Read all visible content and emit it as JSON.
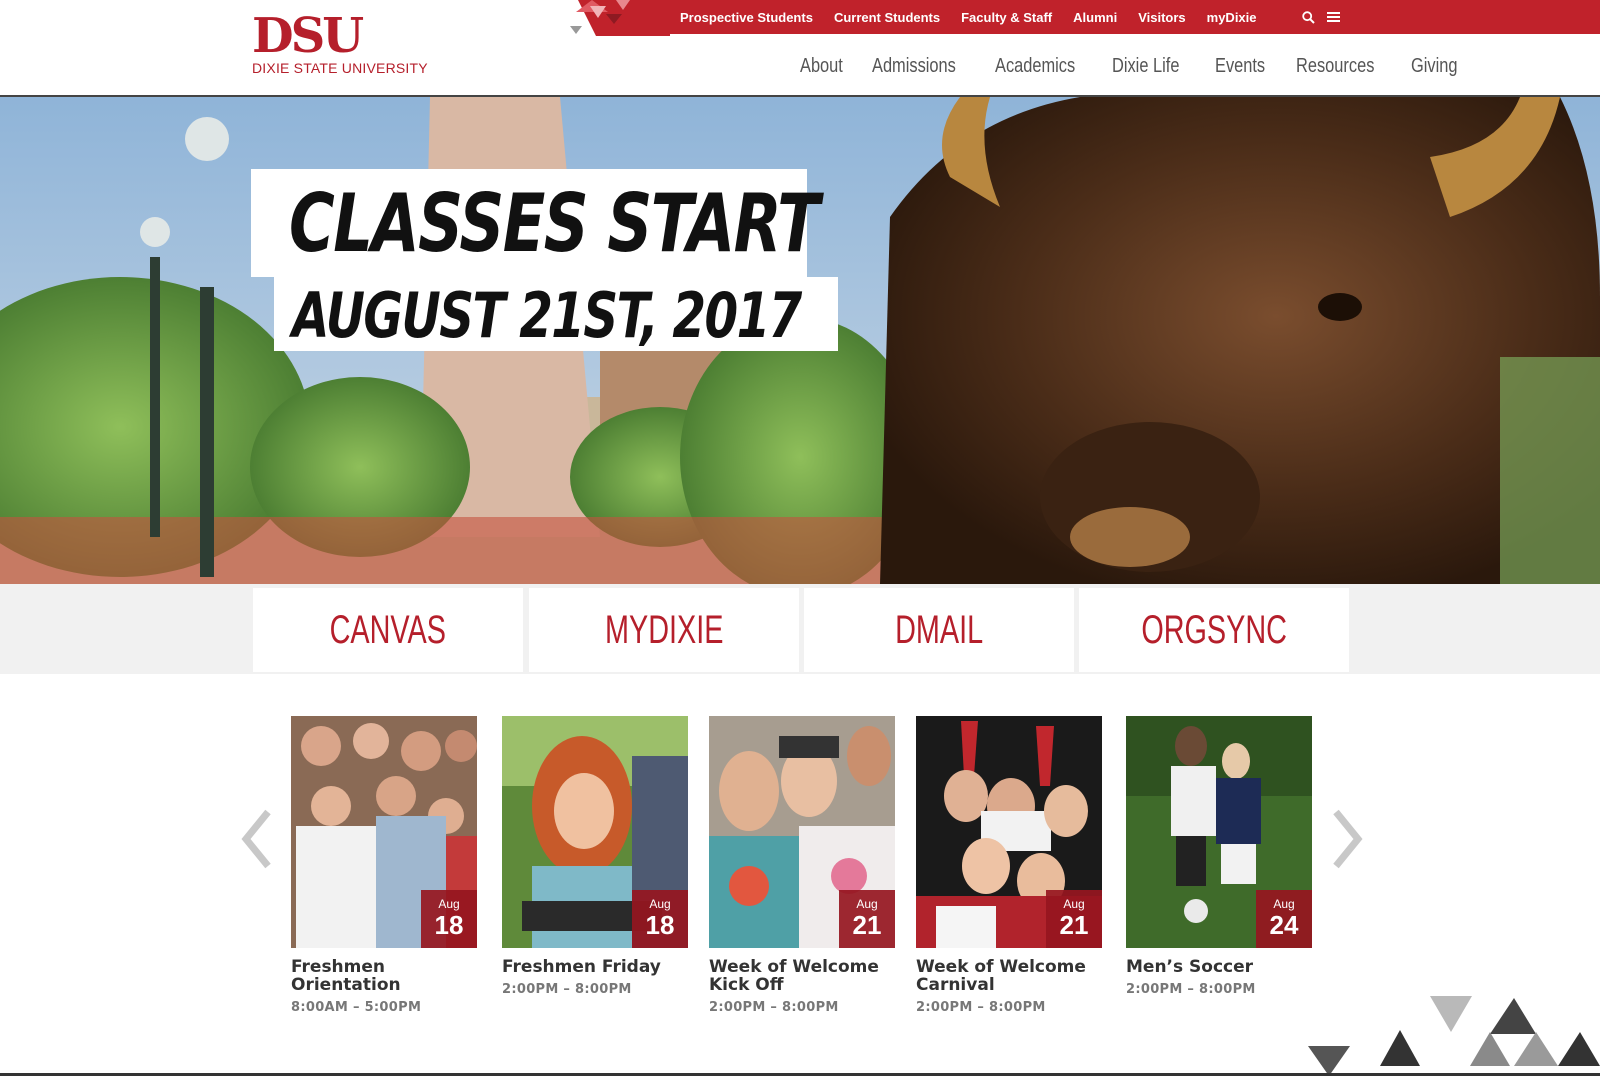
{
  "header": {
    "logo_mark": "DSU",
    "logo_sub": "DIXIE STATE UNIVERSITY",
    "top_links": [
      "Prospective Students",
      "Current Students",
      "Faculty & Staff",
      "Alumni",
      "Visitors",
      "myDixie"
    ],
    "main_links": [
      "About",
      "Admissions",
      "Academics",
      "Dixie Life",
      "Events",
      "Resources",
      "Giving"
    ],
    "icons": [
      "search-icon",
      "menu-icon"
    ]
  },
  "hero": {
    "line1": "CLASSES START",
    "line2": "AUGUST 21ST, 2017"
  },
  "quicklinks": [
    "CANVAS",
    "MYDIXIE",
    "DMAIL",
    "ORGSYNC"
  ],
  "events": [
    {
      "month": "Aug",
      "day": "18",
      "title": "Freshmen Orientation",
      "time": "8:00AM – 5:00PM"
    },
    {
      "month": "Aug",
      "day": "18",
      "title": "Freshmen Friday",
      "time": "2:00PM – 8:00PM"
    },
    {
      "month": "Aug",
      "day": "21",
      "title": "Week of Welcome Kick Off",
      "time": "2:00PM – 8:00PM"
    },
    {
      "month": "Aug",
      "day": "21",
      "title": "Week of Welcome Carnival",
      "time": "2:00PM – 8:00PM"
    },
    {
      "month": "Aug",
      "day": "24",
      "title": "Men’s Soccer",
      "time": "2:00PM – 8:00PM"
    }
  ],
  "colors": {
    "brand_red": "#c0222b",
    "dark_red": "#961620",
    "text_gray": "#555555"
  }
}
